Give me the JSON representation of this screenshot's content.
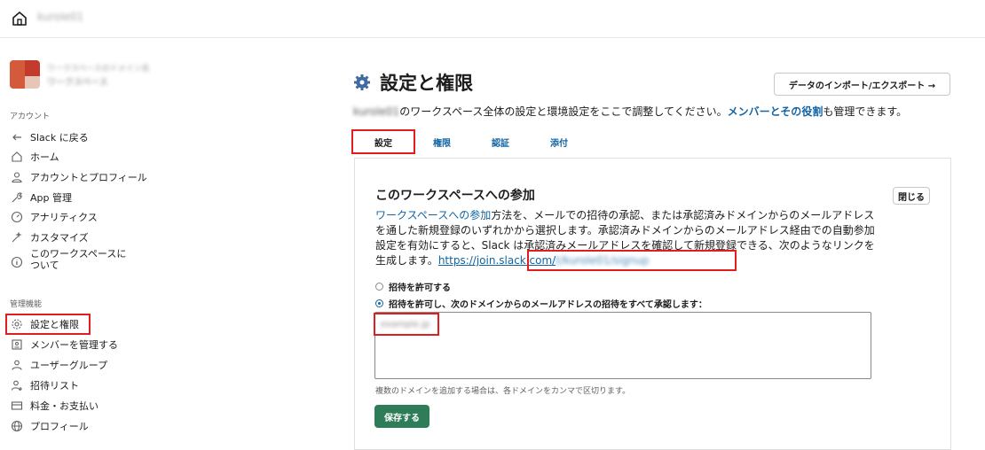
{
  "topbar": {
    "workspace_name": "kurole01"
  },
  "sidebar": {
    "workspace_line1": "ワークスペースのドメイン名",
    "workspace_line2": "ワークスペース",
    "section_account": "アカウント",
    "account_items": [
      {
        "label": "Slack に戻る",
        "icon": "back-arrow-icon"
      },
      {
        "label": "ホーム",
        "icon": "home-icon"
      },
      {
        "label": "アカウントとプロフィール",
        "icon": "person-icon"
      },
      {
        "label": "App 管理",
        "icon": "wrench-icon"
      },
      {
        "label": "アナリティクス",
        "icon": "gauge-icon"
      },
      {
        "label": "カスタマイズ",
        "icon": "sparkle-icon"
      },
      {
        "label": "このワークスペースについて",
        "icon": "info-icon"
      }
    ],
    "section_admin": "管理機能",
    "admin_items": [
      {
        "label": "設定と権限",
        "icon": "gear-icon"
      },
      {
        "label": "メンバーを管理する",
        "icon": "member-card-icon"
      },
      {
        "label": "ユーザーグループ",
        "icon": "user-group-icon"
      },
      {
        "label": "招待リスト",
        "icon": "add-person-icon"
      },
      {
        "label": "料金・お支払い",
        "icon": "card-icon"
      },
      {
        "label": "プロフィール",
        "icon": "globe-icon"
      }
    ]
  },
  "main": {
    "title": "設定と権限",
    "import_button": "データのインポート/エクスポート →",
    "subtitle_prefix": "kurole01",
    "subtitle_text": "のワークスペース全体の設定と環境設定をここで調整してください。",
    "subtitle_link": "メンバーとその役割",
    "subtitle_suffix": "も管理できます。",
    "tabs": [
      {
        "label": "設定"
      },
      {
        "label": "権限"
      },
      {
        "label": "認証"
      },
      {
        "label": "添付"
      }
    ],
    "join": {
      "title": "このワークスペースへの参加",
      "close_button": "閉じる",
      "desc_link": "ワークスペースへの参加",
      "desc_text": "方法を、メールでの招待の承認、または承認済みドメインからのメールアドレスを通した新規登録のいずれかから選択します。承認済みドメインからのメールアドレス経由での自動参加設定を有効にすると、Slack は承認済みメールアドレスを確認して新規登録できる、次のようなリンクを生成します。",
      "url": "https://join.slack.com/",
      "url_blur": "t/kurole01/signup",
      "option1": "招待を許可する",
      "option2": "招待を許可し、次のドメインからのメールアドレスの招待をすべて承認します：",
      "selected_option": 2,
      "domain_value": "example.jp",
      "hint": "複数のドメインを追加する場合は、各ドメインをカンマで区切ります。",
      "save_button": "保存する"
    }
  }
}
